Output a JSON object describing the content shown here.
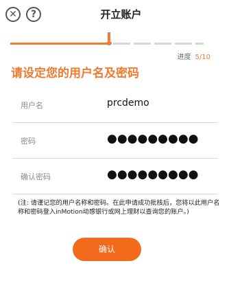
{
  "header": {
    "title": "开立账户",
    "close_icon": "close-icon",
    "help_icon": "help-icon"
  },
  "progress": {
    "label": "进度",
    "value": "5/10",
    "current": 5,
    "total": 10
  },
  "heading": "请设定您的用户名及密码",
  "form": {
    "rows": [
      {
        "label": "用户名",
        "value": "prcdemo"
      },
      {
        "label": "密码",
        "value": "●●●●●●●●●"
      },
      {
        "label": "确认密码",
        "value": "●●●●●●●●●"
      }
    ]
  },
  "note": "(注: 请谨记您的用户名称和密码。在此申请成功批核后，您将以此用户名称和密码登入inMotion动感银行或网上理财以查询您的账户。)",
  "confirm_label": "确认",
  "colors": {
    "accent": "#f07a2f",
    "button": "#f26a1b"
  }
}
